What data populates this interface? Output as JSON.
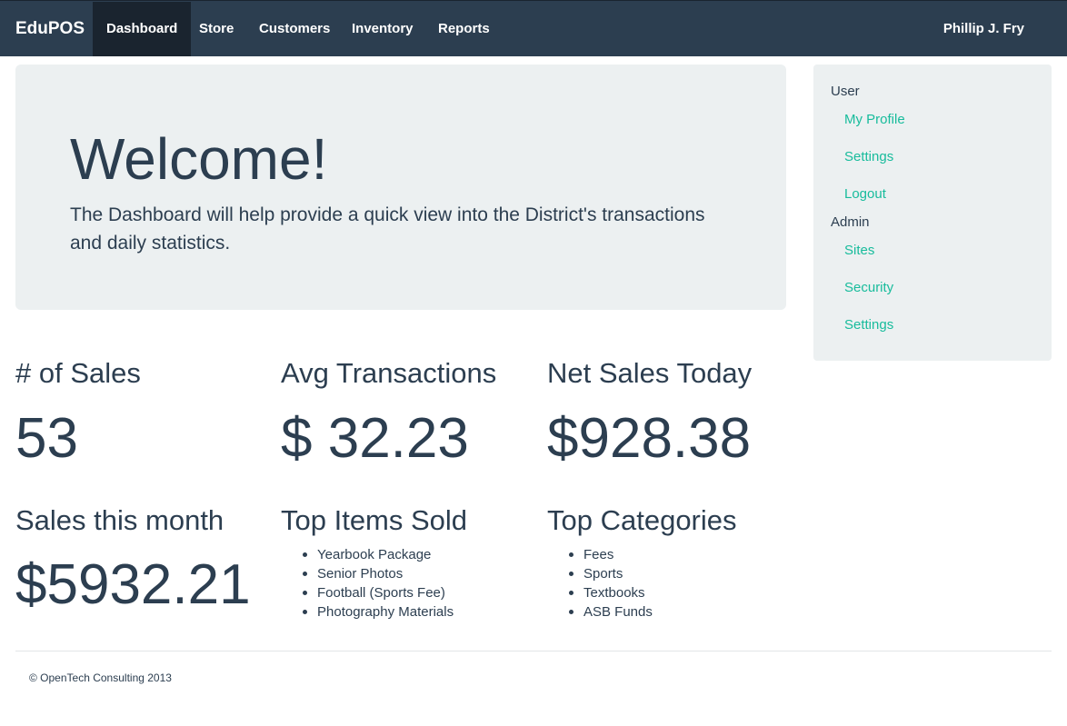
{
  "navbar": {
    "brand": "EduPOS",
    "items": [
      {
        "label": "Dashboard",
        "active": true
      },
      {
        "label": "Store"
      },
      {
        "label": "Customers"
      },
      {
        "label": "Inventory"
      },
      {
        "label": "Reports"
      }
    ],
    "user_name": "Phillip J. Fry"
  },
  "jumbotron": {
    "title": "Welcome!",
    "text": "The Dashboard will help provide a quick view into the District's transactions and daily statistics."
  },
  "sidebar": {
    "user_header": "User",
    "user_links": [
      "My Profile",
      "Settings",
      "Logout"
    ],
    "admin_header": "Admin",
    "admin_links": [
      "Sites",
      "Security",
      "Settings"
    ]
  },
  "stats": {
    "num_sales": {
      "title": "# of Sales",
      "value": "53"
    },
    "avg_transactions": {
      "title": "Avg Transactions",
      "value": "$ 32.23"
    },
    "net_sales_today": {
      "title": "Net Sales Today",
      "value": "$928.38"
    },
    "sales_this_month": {
      "title": "Sales this month",
      "value": "$5932.21"
    }
  },
  "top_items": {
    "title": "Top Items Sold",
    "items": [
      "Yearbook Package",
      "Senior Photos",
      "Football (Sports Fee)",
      "Photography Materials"
    ]
  },
  "top_categories": {
    "title": "Top Categories",
    "items": [
      "Fees",
      "Sports",
      "Textbooks",
      "ASB Funds"
    ]
  },
  "footer": {
    "text": "© OpenTech Consulting 2013"
  },
  "colors": {
    "navbar_bg": "#2c3e50",
    "navbar_active": "#1a242f",
    "panel_bg": "#ecf0f1",
    "link": "#18bc9c",
    "text": "#2c3e50"
  }
}
